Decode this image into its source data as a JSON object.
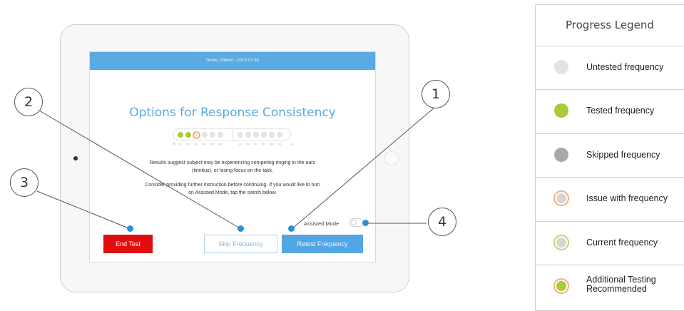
{
  "header": {
    "patient_line": "Name, Patient - 2019-07-30"
  },
  "dialog": {
    "title": "Options for Response Consistency",
    "message_1": "Results suggest subject may be experiencing competing ringing in the ears",
    "message_2": "(tinnitus), or losing focus on the task.",
    "message_3": "Consider providing further instruction before continuing. If you would like to turn",
    "message_4": "on Assisted Mode, tap the switch below."
  },
  "progress_bar": {
    "right_ear_label": "R",
    "left_ear_label": "L",
    "right_frequencies": [
      "1K",
      "2K",
      "4K",
      "8K",
      "500",
      "250"
    ],
    "left_frequencies": [
      "1K",
      "2K",
      "4K",
      "8K",
      "500",
      "250"
    ],
    "right_states": [
      "tested",
      "tested",
      "issue",
      "untested",
      "untested",
      "untested"
    ],
    "left_states": [
      "untested",
      "untested",
      "untested",
      "untested",
      "untested",
      "untested"
    ]
  },
  "assisted_mode": {
    "label": "Assisted Mode",
    "enabled": false
  },
  "buttons": {
    "end_test": "End Test",
    "skip_frequency": "Skip Frequency",
    "retest_frequency": "Retest Frequency"
  },
  "callouts": [
    "1",
    "2",
    "3",
    "4"
  ],
  "legend": {
    "title": "Progress Legend",
    "items": [
      {
        "label": "Untested frequency",
        "fill": "#e3e3e3",
        "ring": ""
      },
      {
        "label": "Tested frequency",
        "fill": "#a7cb3b",
        "ring": ""
      },
      {
        "label": "Skipped frequency",
        "fill": "#a8a8a8",
        "ring": ""
      },
      {
        "label": "Issue with frequency",
        "fill": "#d6d6d6",
        "ring": "#f3b07a"
      },
      {
        "label": "Current frequency",
        "fill": "#d6d6d6",
        "ring": "#bcd86a"
      },
      {
        "label_1": "Additional Testing",
        "label_2": "Recommended",
        "fill": "#a7cb3b",
        "ring": "#f3b07a"
      }
    ]
  },
  "colors": {
    "accent_blue": "#53a6e4",
    "end_test_red": "#e10c0c",
    "tested_green": "#a7cb3b",
    "issue_orange": "#f3b07a"
  }
}
